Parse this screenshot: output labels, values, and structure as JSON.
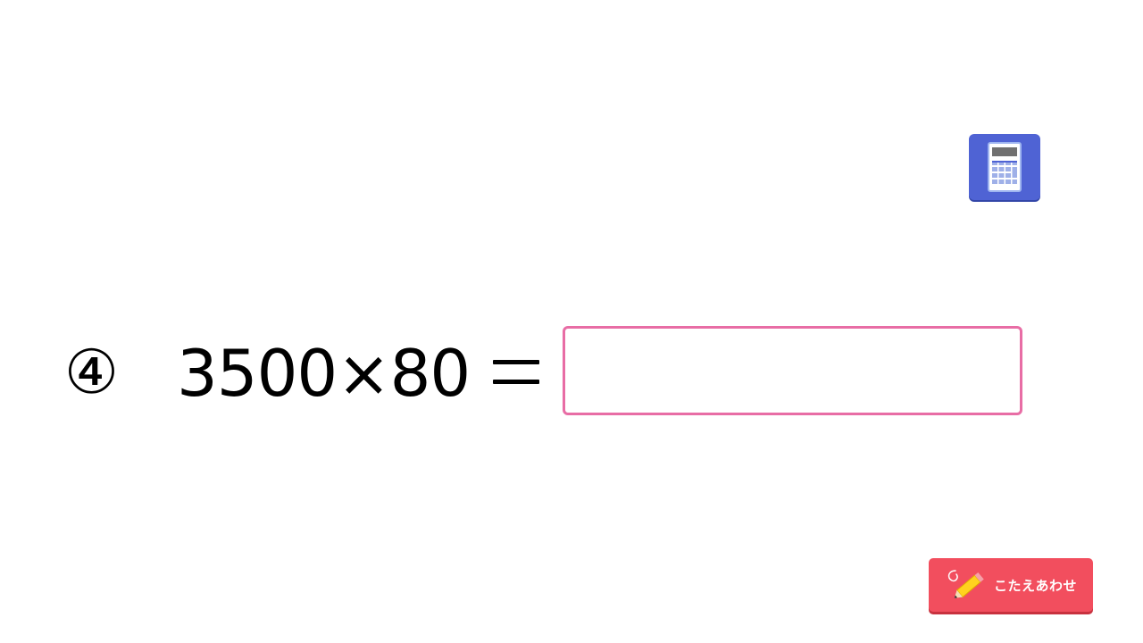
{
  "toolbar": {
    "calculator_icon": "calculator-icon",
    "calculator_color": "#4f63d4"
  },
  "problem": {
    "number": "④",
    "expression": "3500×80",
    "equals_sign": "="
  },
  "answer": {
    "value": "",
    "border_color": "#e86da5"
  },
  "check_button": {
    "label": "こたえあわせ",
    "icon": "pencil-icon",
    "color": "#f24e5e"
  }
}
